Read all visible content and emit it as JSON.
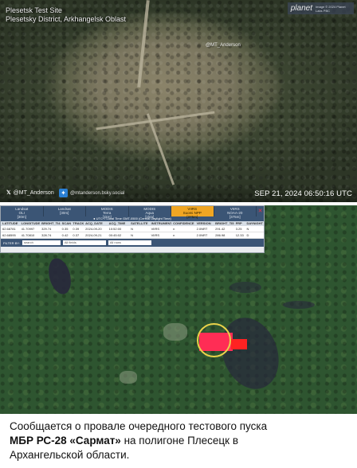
{
  "satellite": {
    "title_line1": "Plesetsk Test Site",
    "title_line2": "Plesetsky District, Arkhangelsk Oblast",
    "watermark": "@MT_Anderson",
    "planet_logo": "planet",
    "planet_fineprint": "Image © 2024 Planet Labs PBC",
    "handle_x": "@MT_Anderson",
    "handle_bsky": "@mtanderson.bsky.social",
    "datestamp": "SEP 21, 2024 06:50:16 UTC"
  },
  "firms": {
    "tabs": [
      {
        "name": "Landsat",
        "sub": "OLI",
        "res": "[30m]"
      },
      {
        "name": "Landsat",
        "sub": "",
        "res": "[30m]"
      },
      {
        "name": "MODIS",
        "sub": "Terra",
        "res": "[1km]"
      },
      {
        "name": "MODIS",
        "sub": "Aqua",
        "res": "[1km]"
      },
      {
        "name": "VIIRS",
        "sub": "Suomi NPP",
        "res": "[375m]",
        "active": true
      },
      {
        "name": "VIIRS",
        "sub": "NOAA-20",
        "res": "[375m]"
      }
    ],
    "timezone": "● UTC  ○ Local Time GMT-0500 (Central Daylight Time)",
    "columns": [
      "LATITUDE",
      "LONGITUDE",
      "BRIGHT_TI4",
      "SCAN",
      "TRACK",
      "ACQ_DATE",
      "ACQ_TIME",
      "SATELLITE",
      "INSTRUMENT",
      "CONFIDENCE",
      "VERSION",
      "BRIGHT_TI5",
      "FRP",
      "DAYNIGHT"
    ],
    "rows": [
      [
        "62.68781",
        "41.70997",
        "329.74",
        "0.35",
        "0.39",
        "2024-09-20",
        "10:52:00",
        "N",
        "VIIRS",
        "n",
        "2.0NRT",
        "291.42",
        "3.25",
        "N"
      ],
      [
        "62.68595",
        "41.70810",
        "328.74",
        "0.42",
        "0.37",
        "2024-09-21",
        "00:45:02",
        "N",
        "VIIRS",
        "n",
        "2.0NRT",
        "286.98",
        "12.33",
        "D"
      ]
    ],
    "filter_label": "FILTER BY:",
    "filter_placeholder": "search",
    "filter_fields": "All fields",
    "filter_rows": "All rows"
  },
  "caption": {
    "line1": "Сообщается о провале очередного тестового пуска",
    "line2_bold": "МБР РС-28 «Сармат»",
    "line2_rest": " на полигоне Плесецк в",
    "line3": "Архангельской области."
  },
  "colors": {
    "active_tab": "#f0a623",
    "panel_header": "#3b5575",
    "hotspot": "#ff2d55",
    "circle": "#e9d24a"
  }
}
